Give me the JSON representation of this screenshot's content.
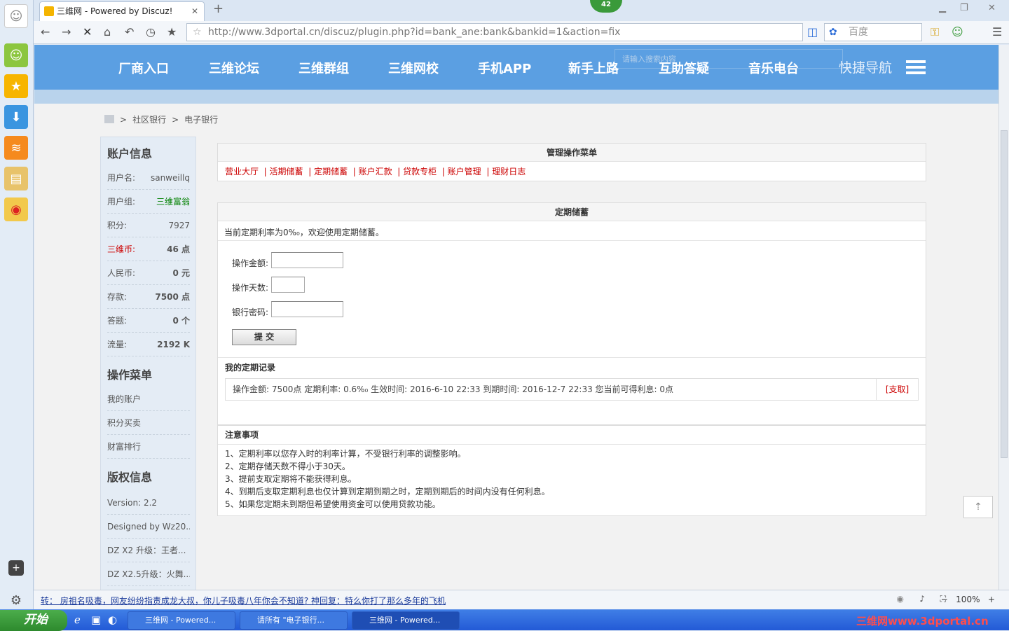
{
  "browser": {
    "tab_title": "三维网 - Powered by Discuz!",
    "badge_count": "42",
    "url": "http://www.3dportal.cn/discuz/plugin.php?id=bank_ane:bank&bankid=1&action=fix",
    "search_engine": "百度"
  },
  "site_nav": {
    "items": [
      "厂商入口",
      "三维论坛",
      "三维群组",
      "三维网校",
      "手机APP",
      "新手上路",
      "互助答疑",
      "音乐电台"
    ],
    "quick_nav": "快捷导航",
    "search_placeholder": "请输入搜索内容"
  },
  "breadcrumb": {
    "sep": ">",
    "items": [
      "社区银行",
      "电子银行"
    ]
  },
  "sidebar": {
    "account_title": "账户信息",
    "account_rows": [
      {
        "label": "用户名:",
        "value": "sanweillq"
      },
      {
        "label": "用户组:",
        "value": "三维富翁"
      },
      {
        "label": "积分:",
        "value": "7927"
      },
      {
        "label": "三维币:",
        "value": "46 点"
      },
      {
        "label": "人民币:",
        "value": "0 元"
      },
      {
        "label": "存款:",
        "value": "7500 点"
      },
      {
        "label": "答题:",
        "value": "0 个"
      },
      {
        "label": "流量:",
        "value": "2192 K"
      }
    ],
    "menu_title": "操作菜单",
    "menu_items": [
      "我的账户",
      "积分买卖",
      "财富排行"
    ],
    "copyright_title": "版权信息",
    "copyright_rows": [
      "Version: 2.2",
      "Designed by Wz20...",
      "DZ X2 升级：王者...",
      "DZ X2.5升级：火舞..."
    ]
  },
  "admin_menu": {
    "title": "管理操作菜单",
    "items": [
      "营业大厅",
      "活期储蓄",
      "定期储蓄",
      "账户汇款",
      "贷款专柜",
      "账户管理",
      "理财日志"
    ]
  },
  "fixed": {
    "title": "定期储蓄",
    "intro": "当前定期利率为0%₀，欢迎使用定期储蓄。",
    "amount_label": "操作金额:",
    "days_label": "操作天数:",
    "password_label": "银行密码:",
    "submit": "提 交",
    "records_title": "我的定期记录",
    "record": "操作金额: 7500点    定期利率: 0.6%₀    生效时间: 2016-6-10 22:33    到期时间: 2016-12-7 22:33    您当前可得利息: 0点",
    "record_action": "[支取]"
  },
  "notes": {
    "title": "注意事项",
    "items": [
      "1、定期利率以您存入时的利率计算，不受银行利率的调整影响。",
      "2、定期存储天数不得小于30天。",
      "3、提前支取定期将不能获得利息。",
      "4、到期后支取定期利息也仅计算到定期到期之时，定期到期后的时间内没有任何利息。",
      "5、如果您定期未到期但希望使用资金可以使用贷款功能。"
    ]
  },
  "status": {
    "news": "转： 房祖名吸毒，网友纷纷指责成龙大叔，你儿子吸毒八年你会不知道? 神回复：特么你打了那么多年的飞机",
    "zoom": "100%"
  },
  "taskbar": {
    "start": "开始",
    "items": [
      "三维网 - Powered...",
      "请所有 \"电子银行...",
      "三维网 - Powered..."
    ],
    "brand": "三维网www.3dportal.cn"
  },
  "colors": {
    "header": "#5b9fe2",
    "link_red": "#cc0000",
    "group_green": "#008000"
  }
}
